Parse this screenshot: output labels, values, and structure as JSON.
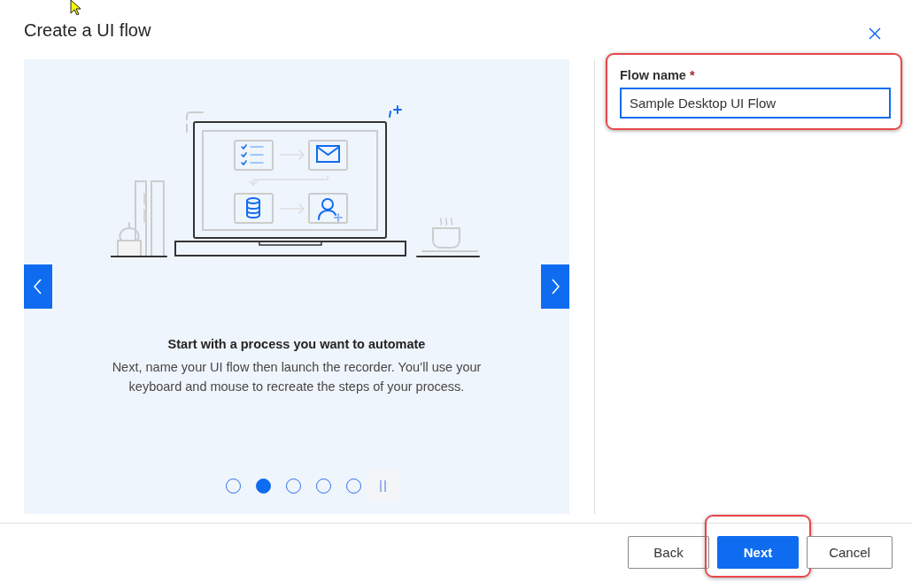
{
  "dialog": {
    "title": "Create a UI flow"
  },
  "carousel": {
    "heading": "Start with a process you want to automate",
    "body": "Next, name your UI flow then launch the recorder. You’ll use your keyboard and mouse to recreate the steps of your process.",
    "dots": [
      {
        "selected": false
      },
      {
        "selected": true
      },
      {
        "selected": false
      },
      {
        "selected": false
      },
      {
        "selected": false
      }
    ]
  },
  "flow_name": {
    "label": "Flow name",
    "required_mark": "*",
    "value": "Sample Desktop UI Flow",
    "highlighted": true
  },
  "buttons": [
    {
      "label": "Back",
      "kind": "secondary",
      "highlighted": false
    },
    {
      "label": "Next",
      "kind": "primary",
      "highlighted": true
    },
    {
      "label": "Cancel",
      "kind": "secondary",
      "highlighted": false
    }
  ]
}
